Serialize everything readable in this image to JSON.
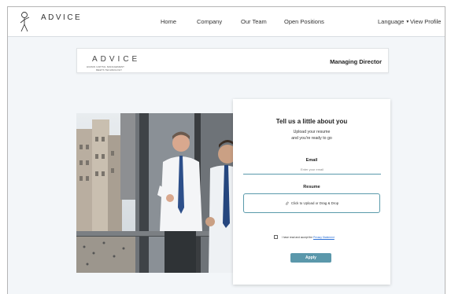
{
  "brand": {
    "logo_text": "ADVICE"
  },
  "nav": {
    "items": [
      {
        "label": "Home"
      },
      {
        "label": "Company"
      },
      {
        "label": "Our Team"
      },
      {
        "label": "Open Positions"
      }
    ],
    "language_label": "Language",
    "profile_label": "View Profile"
  },
  "banner": {
    "logo_text": "ADVICE",
    "tagline_line1": "HUMAN CAPITAL MANAGEMENT",
    "tagline_line2": "MEETS TECHNOLOGY",
    "role_title": "Managing Director"
  },
  "form": {
    "title": "Tell us a little about you",
    "subtitle_line1": "Upload your resume",
    "subtitle_line2": "and you're ready to go",
    "email_label": "Email",
    "email_placeholder": "Enter your email",
    "resume_label": "Resume",
    "upload_text": "Click to Upload or Drag & Drop",
    "consent_text": "I have read and accept the",
    "privacy_link": "Privacy Statement",
    "apply_label": "Apply"
  },
  "colors": {
    "accent": "#5b98ab",
    "link": "#2a6fd6",
    "page_bg": "#f3f6f9"
  },
  "icons": {
    "logo_figure": "stick-figure-logo-icon",
    "upload": "paperclip-icon",
    "language_dropdown": "caret-down-icon"
  }
}
